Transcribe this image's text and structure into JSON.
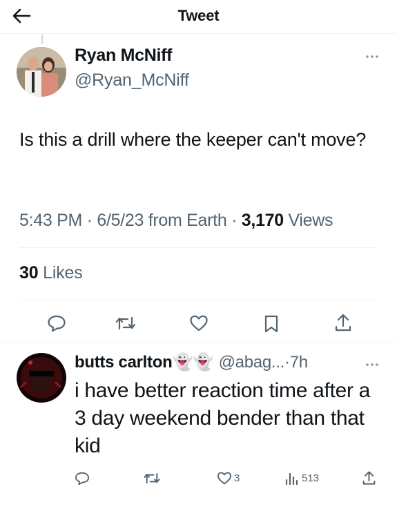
{
  "header": {
    "title": "Tweet",
    "back_icon": "arrow-left-icon"
  },
  "tweet": {
    "author_name": "Ryan McNiff",
    "author_handle": "@Ryan_McNiff",
    "text": "Is this a drill where the keeper can't move?",
    "time": "5:43 PM",
    "date": "6/5/23",
    "source": "from Earth",
    "views_count": "3,170",
    "views_label": "Views",
    "likes_count": "30",
    "likes_label": "Likes",
    "actions": [
      "reply-icon",
      "retweet-icon",
      "like-icon",
      "bookmark-icon",
      "share-icon"
    ]
  },
  "reply": {
    "author_name": "butts carlton",
    "emojis": "👻👻",
    "handle": "@abag...",
    "time": "7h",
    "text": "i have better reaction time after a 3 day weekend bender than that kid",
    "like_count": "3",
    "views_count": "513",
    "actions": [
      "reply-icon",
      "retweet-icon",
      "like-icon",
      "views-icon",
      "share-icon"
    ]
  },
  "colors": {
    "text": "#0f1419",
    "secondary": "#536471",
    "divider": "#eff3f4"
  }
}
